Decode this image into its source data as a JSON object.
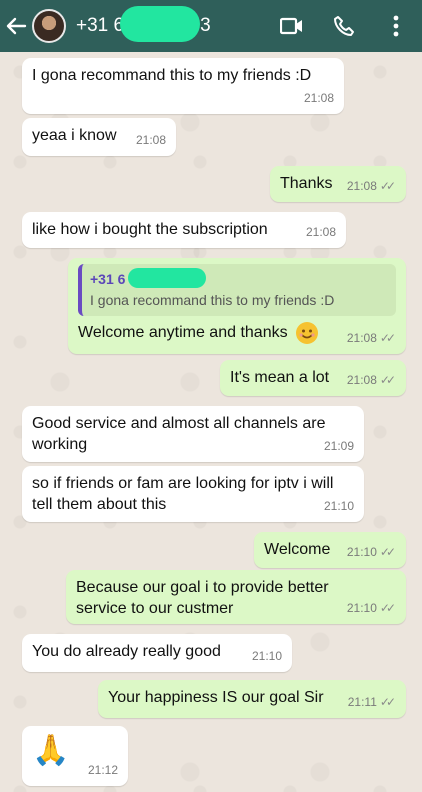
{
  "header": {
    "contact_name": "+31 6",
    "contact_suffix": "3",
    "icons": [
      "back-arrow-icon",
      "video-call-icon",
      "phone-call-icon",
      "more-options-icon"
    ]
  },
  "colors": {
    "header": "#2f5f5a",
    "outgoing_bubble": "#dcf8c6",
    "incoming_bubble": "#ffffff",
    "redaction": "#22e6a0",
    "quote_bar": "#6a4bc2"
  },
  "messages": [
    {
      "dir": "in",
      "text": "I gona recommand this to my friends :D",
      "time": "21:08"
    },
    {
      "dir": "in",
      "text": "yeaa i know",
      "time": "21:08"
    },
    {
      "dir": "out",
      "text": "Thanks",
      "time": "21:08"
    },
    {
      "dir": "in",
      "text": "like how i bought the subscription",
      "time": "21:08"
    },
    {
      "dir": "out",
      "quote_name": "+31 6",
      "quote_text": "I gona recommand this to my friends :D",
      "text": "Welcome anytime and thanks",
      "time": "21:08"
    },
    {
      "dir": "out",
      "text": "It's mean a lot",
      "time": "21:08"
    },
    {
      "dir": "in",
      "text": "Good service and almost all channels are working",
      "time": "21:09"
    },
    {
      "dir": "in",
      "text": "so if friends or fam are looking for iptv i will tell them about this",
      "time": "21:10"
    },
    {
      "dir": "out",
      "text": "Welcome",
      "time": "21:10"
    },
    {
      "dir": "out",
      "text": "Because our goal i to provide better service to our custmer",
      "time": "21:10"
    },
    {
      "dir": "in",
      "text": "You do already really good",
      "time": "21:10"
    },
    {
      "dir": "out",
      "text": "Your happiness IS our goal Sir",
      "time": "21:11"
    },
    {
      "dir": "in",
      "text": "🙏",
      "time": "21:12"
    }
  ]
}
